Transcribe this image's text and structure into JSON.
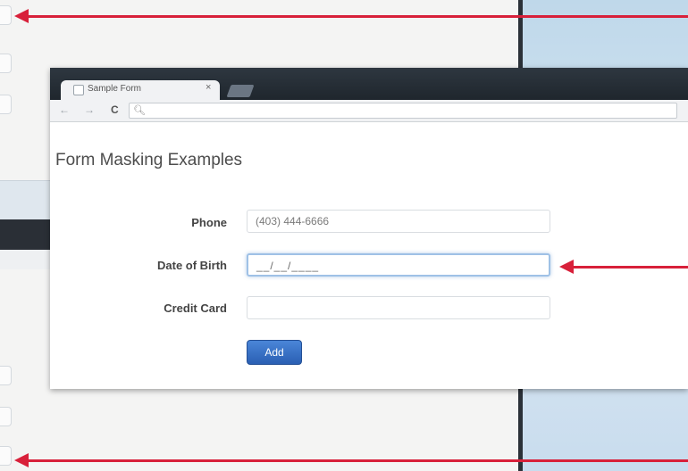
{
  "browser": {
    "tab_title": "Sample Form",
    "tab_close": "×",
    "nav_back": "←",
    "nav_forward": "→",
    "nav_reload": "C",
    "omnibox_icon": "search-icon"
  },
  "form": {
    "heading": "Form Masking Examples",
    "fields": [
      {
        "label": "Phone",
        "value": "(403) 444-6666"
      },
      {
        "label": "Date of Birth",
        "value": "__/__/____"
      },
      {
        "label": "Credit Card",
        "value": ""
      }
    ],
    "add_label": "Add"
  },
  "colors": {
    "arrow": "#d8203a",
    "button": "#2a5fb3",
    "focus_border": "#9fc1e6"
  }
}
